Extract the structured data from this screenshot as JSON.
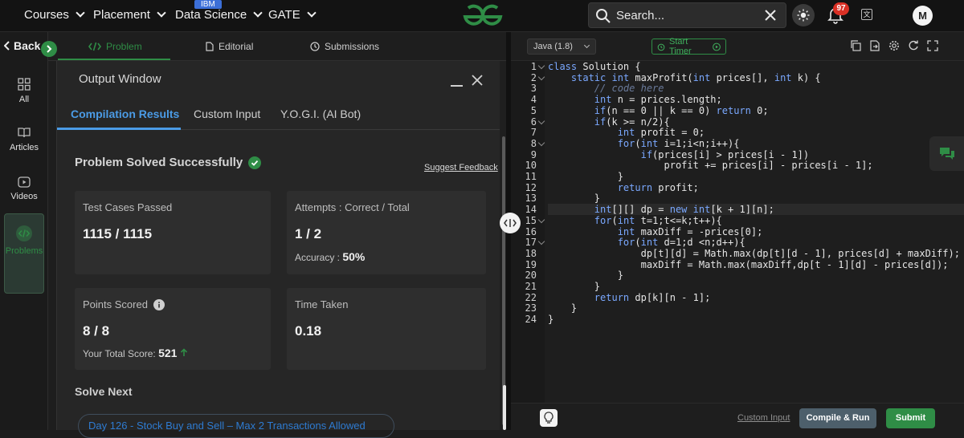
{
  "nav": {
    "items": [
      {
        "label": "Courses"
      },
      {
        "label": "Placement"
      },
      {
        "label": "Data Science"
      },
      {
        "label": "GATE"
      }
    ],
    "ibm_badge": "IBM",
    "search_placeholder": "Search...",
    "notifications_count": "97",
    "avatar_initial": "M",
    "brand_color": "#2f8d46"
  },
  "rail": {
    "back_label": "Back",
    "items": [
      {
        "label": "All",
        "icon": "grid-icon"
      },
      {
        "label": "Articles",
        "icon": "book-icon"
      },
      {
        "label": "Videos",
        "icon": "video-icon"
      },
      {
        "label": "Problems",
        "icon": "code-icon"
      }
    ]
  },
  "tabs": [
    {
      "label": "Problem",
      "icon": "code-icon"
    },
    {
      "label": "Editorial",
      "icon": "document-icon"
    },
    {
      "label": "Submissions",
      "icon": "clock-icon"
    }
  ],
  "output": {
    "title": "Output Window",
    "tabs": [
      "Compilation Results",
      "Custom Input",
      "Y.O.G.I. (AI Bot)"
    ],
    "status": "Problem Solved Successfully",
    "feedback_link": "Suggest Feedback",
    "cards": {
      "test_cases_label": "Test Cases Passed",
      "test_cases_value": "1115 / 1115",
      "attempts_label": "Attempts : Correct / Total",
      "attempts_value": "1 / 2",
      "accuracy_label": "Accuracy :",
      "accuracy_value": "50%",
      "points_label": "Points Scored",
      "points_value": "8 / 8",
      "total_score_label": "Your Total Score:",
      "total_score_value": "521",
      "time_label": "Time Taken",
      "time_value": "0.18"
    },
    "solve_next_label": "Solve Next",
    "next_problem": "Day 126 - Stock Buy and Sell – Max 2 Transactions Allowed"
  },
  "editor": {
    "language": "Java (1.8)",
    "timer_label": "Start Timer",
    "code_lines": [
      "class Solution {",
      "    static int maxProfit(int prices[], int k) {",
      "        // code here",
      "        int n = prices.length;",
      "        if(n == 0 || k == 0) return 0;",
      "        if(k >= n/2){",
      "            int profit = 0;",
      "            for(int i=1;i<n;i++){",
      "                if(prices[i] > prices[i - 1])",
      "                    profit += prices[i] - prices[i - 1];",
      "            }",
      "            return profit;",
      "        }",
      "        int[][] dp = new int[k + 1][n];",
      "        for(int t=1;t<=k;t++){",
      "            int maxDiff = -prices[0];",
      "            for(int d=1;d <n;d++){",
      "                dp[t][d] = Math.max(dp[t][d - 1], prices[d] + maxDiff);",
      "                maxDiff = Math.max(maxDiff,dp[t - 1][d] - prices[d]);",
      "            }",
      "        }",
      "        return dp[k][n - 1];",
      "    }",
      "}"
    ],
    "custom_input_label": "Custom Input",
    "compile_label": "Compile & Run",
    "submit_label": "Submit"
  }
}
